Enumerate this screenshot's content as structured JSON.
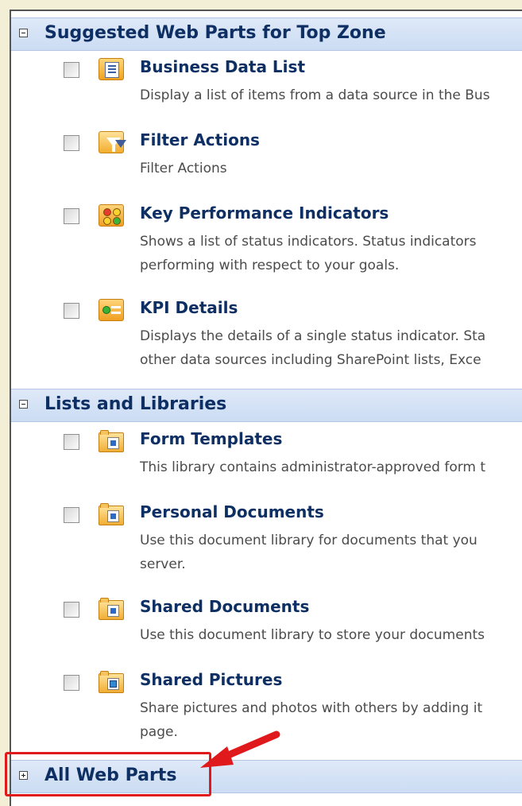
{
  "sections": [
    {
      "title": "Suggested Web Parts for Top Zone",
      "expanded": true,
      "items": [
        {
          "title": "Business Data List",
          "icon": "business-data-list-icon",
          "checked": false,
          "description": [
            "Display a list of items from a data source in the Bus"
          ]
        },
        {
          "title": "Filter Actions",
          "icon": "filter-actions-icon",
          "checked": false,
          "description": [
            "Filter Actions"
          ]
        },
        {
          "title": "Key Performance Indicators",
          "icon": "kpi-icon",
          "checked": false,
          "description": [
            "Shows a list of status indicators. Status indicators",
            "performing with respect to your goals."
          ]
        },
        {
          "title": "KPI Details",
          "icon": "kpi-details-icon",
          "checked": false,
          "description": [
            "Displays the details of a single status indicator. Sta",
            "other data sources including SharePoint lists, Exce"
          ]
        }
      ]
    },
    {
      "title": "Lists and Libraries",
      "expanded": true,
      "items": [
        {
          "title": "Form Templates",
          "icon": "document-library-icon",
          "checked": false,
          "description": [
            "This library contains administrator-approved form t"
          ]
        },
        {
          "title": "Personal Documents",
          "icon": "document-library-icon",
          "checked": false,
          "description": [
            "Use this document library for documents that you",
            "server."
          ]
        },
        {
          "title": "Shared Documents",
          "icon": "document-library-icon",
          "checked": false,
          "description": [
            "Use this document library to store your documents"
          ]
        },
        {
          "title": "Shared Pictures",
          "icon": "picture-library-icon",
          "checked": false,
          "description": [
            "Share pictures and photos with others by adding it",
            "page."
          ]
        }
      ]
    },
    {
      "title": "All Web Parts",
      "expanded": false,
      "items": []
    }
  ],
  "colors": {
    "header_text": "#0d2f63",
    "header_bg": "#d6e3f6",
    "description_text": "#4b4b4b",
    "highlight": "#e0191c"
  }
}
